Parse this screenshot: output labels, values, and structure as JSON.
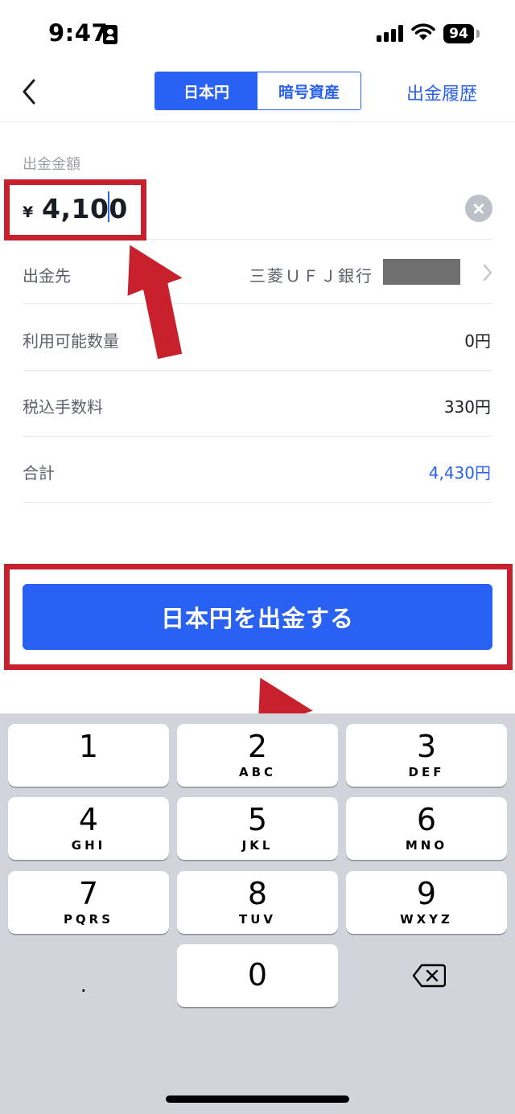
{
  "status_bar": {
    "time": "9:47",
    "battery": "94"
  },
  "header": {
    "tabs": [
      {
        "label": "日本円",
        "active": true
      },
      {
        "label": "暗号資産",
        "active": false
      }
    ],
    "history_link": "出金履歴"
  },
  "form": {
    "amount_label": "出金金額",
    "currency_symbol": "¥",
    "amount": "4,100",
    "destination_label": "出金先",
    "destination_bank": "三菱ＵＦＪ銀行",
    "rows": [
      {
        "label": "利用可能数量",
        "value": "0円"
      },
      {
        "label": "税込手数料",
        "value": "330円"
      },
      {
        "label": "合計",
        "value": "4,430円"
      }
    ]
  },
  "submit": {
    "label": "日本円を出金する"
  },
  "keyboard": {
    "keys": [
      {
        "digit": "1",
        "letters": ""
      },
      {
        "digit": "2",
        "letters": "ABC"
      },
      {
        "digit": "3",
        "letters": "DEF"
      },
      {
        "digit": "4",
        "letters": "GHI"
      },
      {
        "digit": "5",
        "letters": "JKL"
      },
      {
        "digit": "6",
        "letters": "MNO"
      },
      {
        "digit": "7",
        "letters": "PQRS"
      },
      {
        "digit": "8",
        "letters": "TUV"
      },
      {
        "digit": "9",
        "letters": "WXYZ"
      },
      {
        "digit": "0",
        "letters": ""
      }
    ],
    "decimal": "."
  },
  "colors": {
    "accent": "#2962f3",
    "annotation": "#c8202d",
    "keyboard_bg": "#d1d4da"
  }
}
